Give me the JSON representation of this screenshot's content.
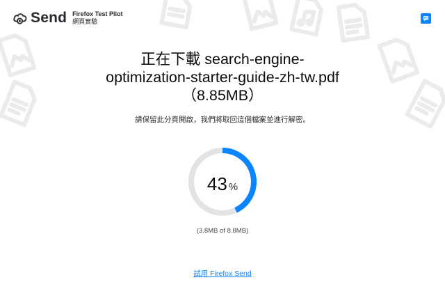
{
  "header": {
    "app_name": "Send",
    "pilot_title": "Firefox Test Pilot",
    "pilot_subtitle": "網頁實驗"
  },
  "download": {
    "title": "正在下載 search-engine-optimization-starter-guide-zh-tw.pdf（8.85MB）",
    "message": "請保留此分頁開啟，我們將取回這個檔案並進行解密。",
    "progress_percent": 43,
    "percent_sign": "%",
    "size_progress": "(3.8MB of 8.8MB)"
  },
  "footer": {
    "try_link": "試用 Firefox Send"
  },
  "colors": {
    "accent": "#0a84ff",
    "progress_track": "#e3e3e5",
    "background_icons": "#ebebee"
  },
  "icons": [
    "send-logo-icon",
    "feedback-chat-icon",
    "image-file-icon",
    "music-file-icon",
    "document-file-icon"
  ]
}
